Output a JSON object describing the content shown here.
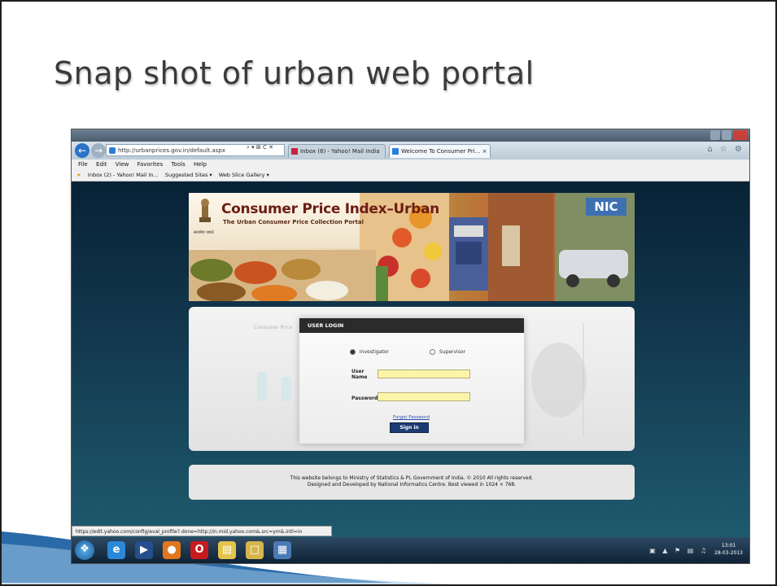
{
  "slide": {
    "title": "Snap shot of urban web portal"
  },
  "browser": {
    "address_url": "http://urbanprices.gov.in/default.aspx",
    "address_actions": "⌕ ▾ ⊞ C ✕",
    "tabs": [
      {
        "label": "Inbox (6) - Yahoo! Mail India"
      },
      {
        "label": "Welcome To Consumer Pri...  ×"
      }
    ],
    "right_icons": "⌂ ☆ ⚙",
    "menu": [
      "File",
      "Edit",
      "View",
      "Favorites",
      "Tools",
      "Help"
    ],
    "favorites": [
      "Inbox (2) - Yahoo! Mail In...",
      "Suggested Sites ▾",
      "Web Slice Gallery ▾"
    ],
    "status_url": "https://edit.yahoo.com/config/eval_profile?.done=http://in.mid.yahoo.com&.src=ym&.intl=in"
  },
  "portal": {
    "emblem_caption": "सत्यमेव जयते",
    "title": "Consumer Price Index–Urban",
    "subtitle": "The Urban Consumer Price Collection Portal",
    "nic_logo": "NIC",
    "ghost_heading": "Consumer Price",
    "login": {
      "header": "USER LOGIN",
      "role_options": [
        "Investigator",
        "Supervisor"
      ],
      "selected_role": "Investigator",
      "username_label": "User Name",
      "username_value": "",
      "password_label": "Password",
      "password_value": "",
      "forgot_label": "Forgot Password",
      "signin_label": "Sign in"
    },
    "footer_line1": "This website belongs to Ministry of Statistics & PI, Government of India. © 2010 All rights reserved.",
    "footer_line2": "Designed and Developed by National Informatics Centre. Best viewed in 1024 × 768."
  },
  "taskbar": {
    "clock_time": "13:01",
    "clock_date": "28-03-2013"
  },
  "colors": {
    "taskbar": "#15293c",
    "signin_button": "#1d3b73",
    "field_highlight": "#fcf5a8",
    "wave": "#2a6aa8"
  }
}
